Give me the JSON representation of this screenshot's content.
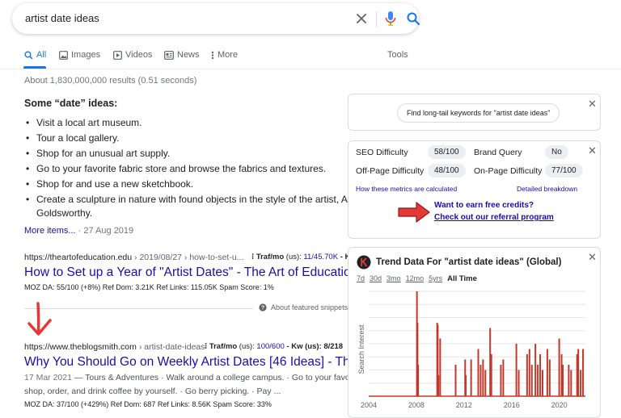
{
  "search": {
    "query": "artist date ideas"
  },
  "tabs": [
    {
      "label": "All"
    },
    {
      "label": "Images"
    },
    {
      "label": "Videos"
    },
    {
      "label": "News"
    },
    {
      "label": "More"
    }
  ],
  "tools_label": "Tools",
  "result_stats": "About 1,830,000,000 results (0.51 seconds)",
  "snippet": {
    "heading": "Some “date” ideas:",
    "items": [
      "Visit a local art museum.",
      "Tour a local gallery.",
      "Shop for an unusual art supply.",
      "Go to your favorite fabric store and browse the fabrics and textures.",
      "Shop for and use a new sketchbook.",
      "Create a sculpture in nature with found objects in the style of the artist, And",
      "Goldsworthy."
    ],
    "more_items": "More items...",
    "date": "27 Aug 2019"
  },
  "result1": {
    "url_domain": "https://theartofeducation.edu",
    "url_path": "› 2019/08/27 › how-to-set-u...",
    "traf_label": "Traf/mo",
    "traf_suffix": "(us):",
    "traf_value": "11/45.70K",
    "traf_extra": "- K",
    "title": "How to Set up a Year of \"Artist Dates\" - The Art of Education ...",
    "metrics": "MOZ DA: 55/100 (+8%)   Ref Dom: 3.21K   Ref Links: 115.05K   Spam Score: 1%"
  },
  "about_snippets": "About featured snippets",
  "result2": {
    "url_domain": "https://www.theblogsmith.com",
    "url_path": "› artist-date-ideas",
    "traf_label": "Traf/mo",
    "traf_suffix": "(us):",
    "traf_value": "100/600",
    "traf_extra": "- Kw (us): 8/218",
    "title": "Why You Should Go on Weekly Artist Dates [46 Ideas] - The ...",
    "date": "17 Mar 2021",
    "desc1": " — Tours & Adventures · Walk around a college campus. · Go to your favorite",
    "desc2": "shop, order, and drink coffee by yourself. · Go berry picking. · Pay ...",
    "metrics": "MOZ DA: 37/100 (+429%)   Ref Dom: 687   Ref Links: 8.56K   Spam Score: 33%"
  },
  "panel_keywords": {
    "button": "Find long-tail keywords for \"artist date ideas\""
  },
  "panel_metrics": {
    "seo_label": "SEO Difficulty",
    "seo_value": "58/100",
    "brand_label": "Brand Query",
    "brand_value": "No",
    "offpage_label": "Off-Page Difficulty",
    "offpage_value": "48/100",
    "onpage_label": "On-Page Difficulty",
    "onpage_value": "77/100",
    "how_link": "How these metrics are calculated",
    "detailed_link": "Detailed breakdown",
    "credits_q": "Want to earn free credits?",
    "credits_link": "Check out our referral program"
  },
  "panel_trend": {
    "title": "Trend Data For \"artist date ideas\" (Global)",
    "ranges": [
      "7d",
      "30d",
      "3mo",
      "12mo",
      "5yrs",
      "All Time"
    ],
    "active_range": "All Time"
  },
  "chart_data": {
    "type": "bar",
    "ylabel": "Search Interest",
    "x_ticks": [
      "2004",
      "2008",
      "2012",
      "2016",
      "2020"
    ],
    "x_range": [
      2004,
      2022.2
    ],
    "y_range": [
      0,
      100
    ],
    "color": "#c0392b",
    "series": [
      {
        "x": [
          2008.05,
          2008.1,
          2008.15
        ],
        "y": [
          100,
          70,
          30
        ]
      },
      {
        "x": [
          2009.75,
          2009.8,
          2009.85
        ],
        "y": [
          70,
          68,
          20
        ]
      },
      {
        "x": [
          2010.0
        ],
        "y": [
          55
        ]
      },
      {
        "x": [
          2011.3
        ],
        "y": [
          30
        ]
      },
      {
        "x": [
          2012.1,
          2012.15
        ],
        "y": [
          35,
          20
        ]
      },
      {
        "x": [
          2012.6
        ],
        "y": [
          35
        ]
      },
      {
        "x": [
          2013.2,
          2013.4,
          2013.6,
          2013.8
        ],
        "y": [
          45,
          30,
          35,
          25
        ]
      },
      {
        "x": [
          2014.2,
          2014.3
        ],
        "y": [
          65,
          40
        ]
      },
      {
        "x": [
          2015.1,
          2015.3
        ],
        "y": [
          30,
          35
        ]
      },
      {
        "x": [
          2016.4,
          2016.6
        ],
        "y": [
          50,
          25
        ]
      },
      {
        "x": [
          2017.3,
          2017.5,
          2017.7
        ],
        "y": [
          40,
          45,
          30
        ]
      },
      {
        "x": [
          2018.0,
          2018.2,
          2018.4,
          2018.6
        ],
        "y": [
          50,
          30,
          40,
          25
        ]
      },
      {
        "x": [
          2019.0,
          2019.2
        ],
        "y": [
          45,
          35
        ]
      },
      {
        "x": [
          2020.0,
          2020.2,
          2020.3
        ],
        "y": [
          55,
          40,
          30
        ]
      },
      {
        "x": [
          2020.8,
          2021.0
        ],
        "y": [
          30,
          25
        ]
      },
      {
        "x": [
          2021.5,
          2021.6,
          2021.8
        ],
        "y": [
          40,
          45,
          25
        ]
      },
      {
        "x": [
          2022.0
        ],
        "y": [
          45
        ]
      }
    ]
  },
  "colors": {
    "accent": "#1a73e8",
    "link": "#1a0dab",
    "trend": "#c0392b",
    "arrow": "#e53935"
  }
}
